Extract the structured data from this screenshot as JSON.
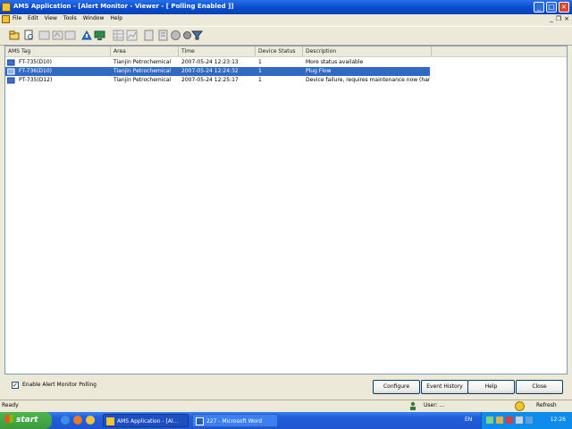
{
  "window": {
    "title": "AMS Application - [Alert Monitor - Viewer - [ Polling Enabled ]]",
    "controls": [
      "minimize",
      "maximize",
      "close"
    ]
  },
  "menu": {
    "items": [
      "File",
      "Edit",
      "View",
      "Tools",
      "Window",
      "Help"
    ],
    "mdi_controls": [
      "_",
      "❐",
      "×"
    ]
  },
  "toolbar": {
    "icons": [
      "open-icon",
      "print-preview-icon",
      "tool-a-icon",
      "tool-b-icon",
      "tool-c-icon",
      "alert-icon",
      "monitor-icon",
      "grid-icon",
      "chart-icon",
      "tag-icon",
      "doc-icon",
      "globe-icon",
      "settings-icon",
      "filter-icon"
    ]
  },
  "table": {
    "columns": [
      "AMS Tag",
      "Area",
      "Time",
      "Device Status",
      "Description"
    ],
    "rows": [
      {
        "tag": "FT-735(D10)",
        "area": "Tianjin Petrochemical",
        "time": "2007-05-24 12:23:13",
        "status": "1",
        "description": "More status available",
        "selected": false
      },
      {
        "tag": "FT-736(D10)",
        "area": "Tianjin Petrochemical",
        "time": "2007-05-24 12:24:32",
        "status": "1",
        "description": "Plug Flow",
        "selected": true
      },
      {
        "tag": "PT-735(D12)",
        "area": "Tianjin Petrochemical",
        "time": "2007-05-24 12:25:17",
        "status": "1",
        "description": "Device failure, requires maintenance now (hard)",
        "selected": false
      }
    ]
  },
  "footer": {
    "checkbox_label": "Enable Alert Monitor Polling",
    "checkbox_checked": true,
    "buttons": {
      "configure": "Configure",
      "event_history": "Event History",
      "help": "Help",
      "close": "Close"
    }
  },
  "status": {
    "text": "Ready",
    "user": "User: ...",
    "refresh": "Refresh"
  },
  "taskbar": {
    "start": "start",
    "tasks": [
      "AMS Application - [Al...",
      "227 - Microsoft Word"
    ],
    "lang": "EN",
    "clock": "12:26"
  }
}
